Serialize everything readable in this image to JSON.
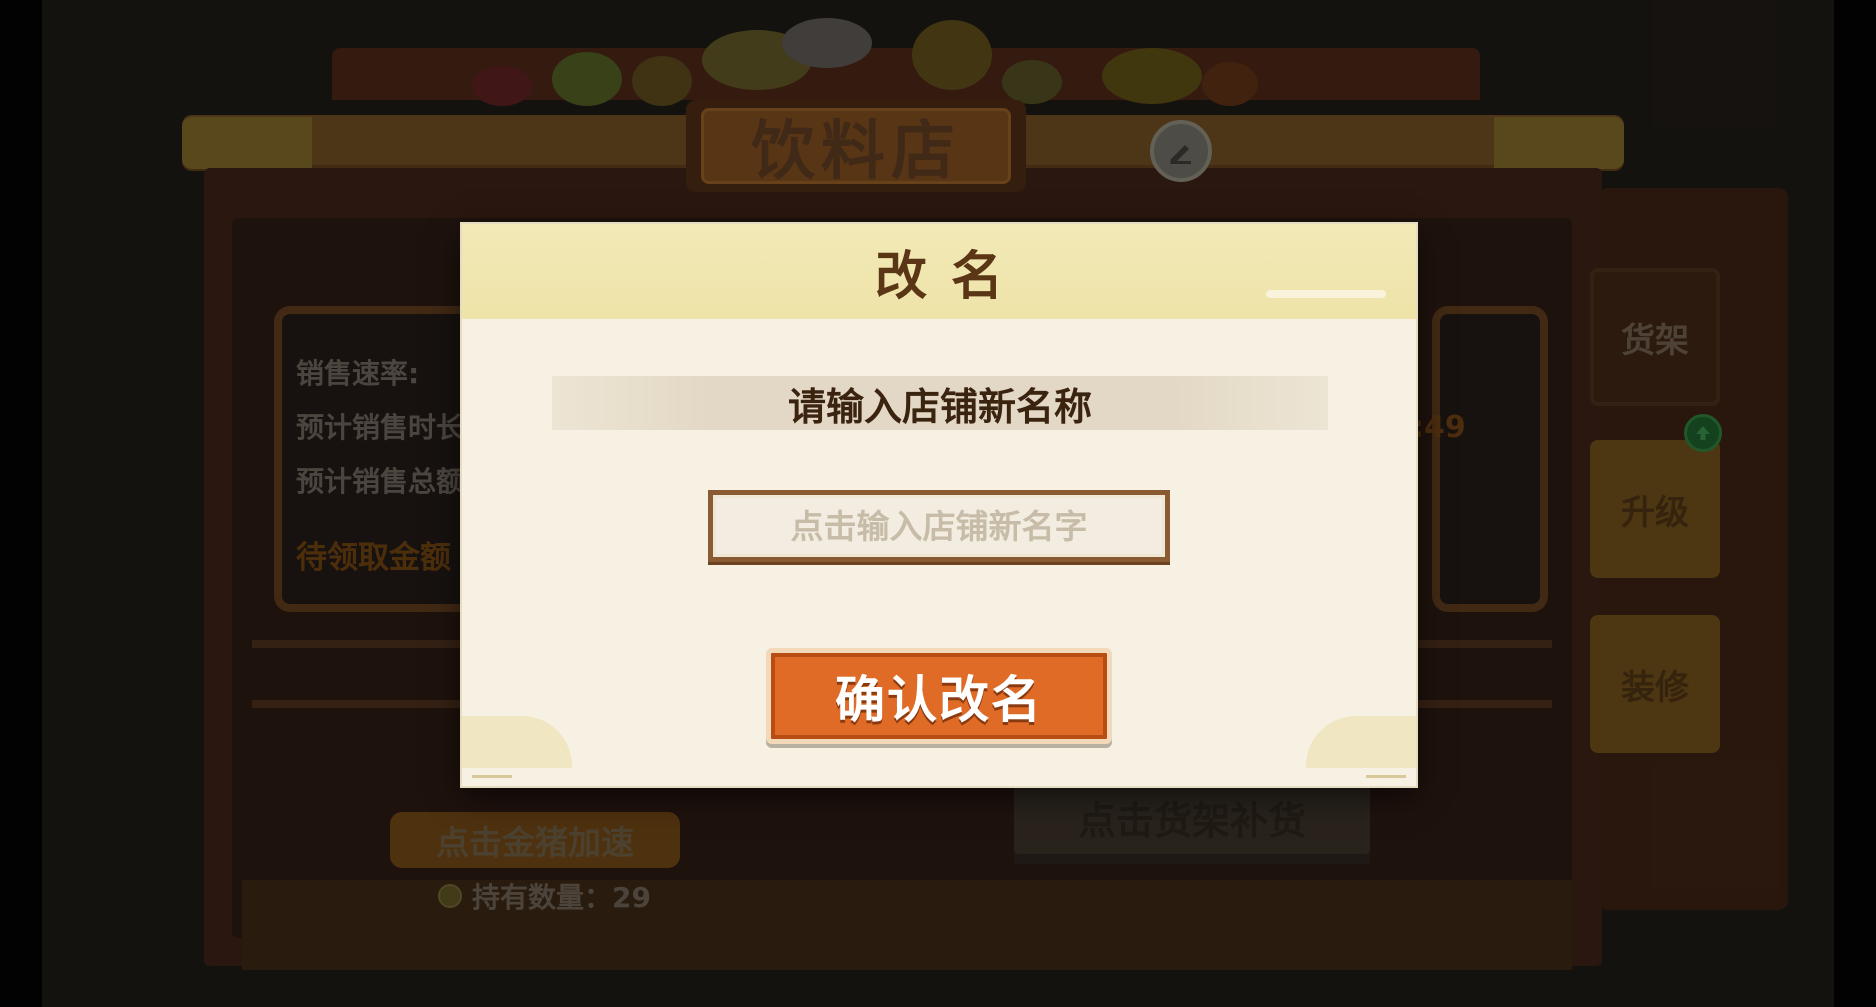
{
  "shop": {
    "name": "饮料店",
    "side_tabs": {
      "shelf": "货架",
      "upgrade": "升级",
      "decorate": "装修"
    },
    "stats": {
      "sales_rate": "销售速率:",
      "est_time": "预计销售时长",
      "est_total": "预计销售总额",
      "pending": "待领取金额",
      "right_value": ":49"
    },
    "gold_pig_button": "点击金猪加速",
    "holding": "持有数量：29",
    "restock": "点击货架补货"
  },
  "modal": {
    "title": "改名",
    "subtitle": "请输入店铺新名称",
    "input": {
      "value": "",
      "placeholder": "点击输入店铺新名字"
    },
    "confirm_button": "确认改名"
  },
  "colors": {
    "modal_bg": "#f6f1e3",
    "header_bg": "#eee3a8",
    "button_orange": "#df6b26",
    "title_brown": "#5a3616"
  },
  "icons": {
    "edit": "pencil-icon",
    "upgrade_badge": "arrow-up-icon",
    "coin": "coin-icon"
  }
}
